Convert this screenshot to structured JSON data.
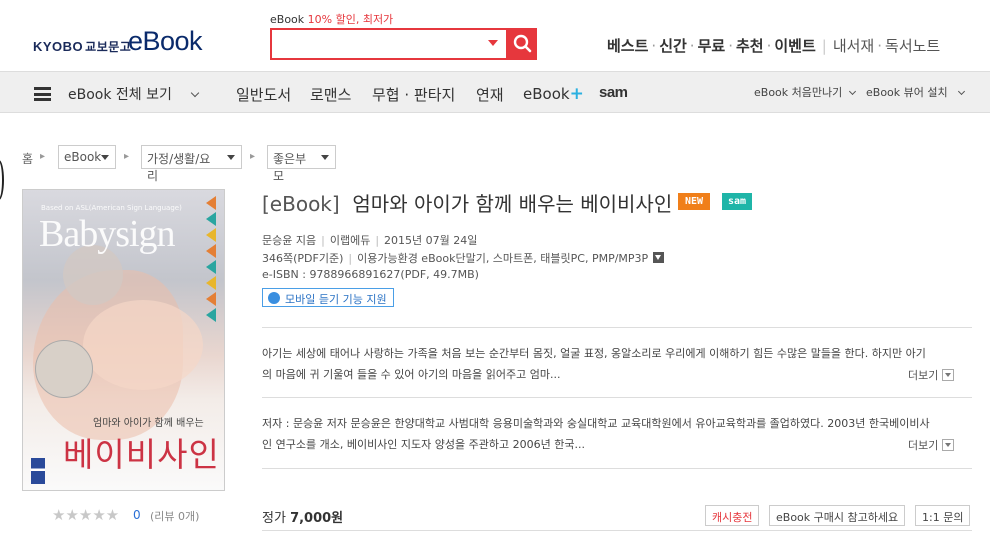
{
  "header": {
    "logo_kyobo": "KYOBO",
    "logo_kyobo_kr": "교보문고",
    "logo_ebook": "eBook",
    "promo_prefix": "eBook ",
    "promo_red": "10% 할인, 최저가",
    "search": {
      "value": "",
      "placeholder": ""
    },
    "top_links": [
      "베스트",
      "신간",
      "무료",
      "추천",
      "이벤트"
    ],
    "top_links_right": [
      "내서재",
      "독서노트"
    ]
  },
  "nav": {
    "all_label": "eBook 전체 보기",
    "menu": [
      "일반도서",
      "로맨스",
      "무협 · 판타지",
      "연재"
    ],
    "ebook_plus": "eBook",
    "plus_sign": "+",
    "sam": "sam",
    "right": [
      "eBook 처음만나기",
      "eBook 뷰어 설치"
    ]
  },
  "breadcrumb": {
    "home": "홈",
    "levels": [
      "eBook",
      "가정/생활/요리",
      "좋은부모"
    ]
  },
  "cover": {
    "small_en": "Based on ASL(American Sign Language)",
    "babysign": "Babysign",
    "subtitle": "엄마와 아이가 함께 배우는",
    "title": "베이비사인"
  },
  "rating": {
    "stars": "★★★★★",
    "score": "0",
    "reviews": "(리뷰 0개)"
  },
  "book": {
    "tag": "[eBook]",
    "title": "엄마와 아이가 함께 배우는 베이비사인",
    "badge_new": "NEW",
    "badge_sam": "sam",
    "author": "문승윤 지음",
    "publisher": "이랩에듀",
    "date": "2015년 07월 24일",
    "pages": "346쪽(PDF기준)",
    "devices": "이용가능환경 eBook단말기, 스마트폰, 태블릿PC, PMP/MP3P",
    "isbn": "e-ISBN : 9788966891627(PDF, 49.7MB)",
    "audio": "모바일 듣기 기능 지원",
    "desc_line1": "아기는 세상에 태어나 사랑하는 가족을 처음 보는 순간부터 몸짓, 얼굴 표정, 옹알소리로 우리에게 이해하기 힘든 수많은 말들을 한다. 하지만 아기",
    "desc_line2": "의 마음에 귀 기울여 들을 수 있어 아기의 마음을 읽어주고 엄마...",
    "more": "더보기",
    "author_line1": "저자 : 문승윤 저자 문승윤은 한양대학교 사범대학 응용미술학과와 숭실대학교 교육대학원에서 유아교육학과를 졸업하였다. 2003년 한국베이비사",
    "author_line2": "인 연구소를 개소, 베이비사인 지도자 양성을 주관하고 2006년 한국...",
    "price_label": "정가",
    "price_value": "7,000원",
    "btn_cash": "캐시충전",
    "btn_ref": "eBook 구매시 참고하세요",
    "btn_qna": "1:1 문의"
  }
}
